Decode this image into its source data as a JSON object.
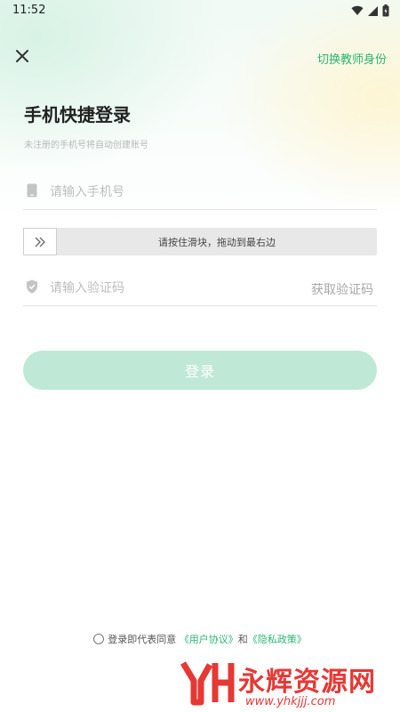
{
  "status_bar": {
    "time": "11:52"
  },
  "header": {
    "switch_role_label": "切换教师身份"
  },
  "login": {
    "title": "手机快捷登录",
    "subtitle": "未注册的手机号将自动创建账号",
    "phone_placeholder": "请输入手机号",
    "slider_text": "请按住滑块，拖动到最右边",
    "code_placeholder": "请输入验证码",
    "get_code_label": "获取验证码",
    "submit_label": "登录"
  },
  "agreement": {
    "prefix": "登录即代表同意",
    "user_agreement": "《用户协议》",
    "and": "和",
    "privacy_policy": "《隐私政策》"
  },
  "watermark": {
    "name": "永辉资源网",
    "url": "www.yhkjjj.com"
  },
  "colors": {
    "accent": "#2bb575",
    "button_disabled": "#bfe9d6",
    "watermark": "#e53935"
  },
  "icons": [
    "wifi-icon",
    "signal-icon",
    "battery-icon",
    "close-icon",
    "phone-icon",
    "double-chevron-right-icon",
    "shield-icon"
  ]
}
